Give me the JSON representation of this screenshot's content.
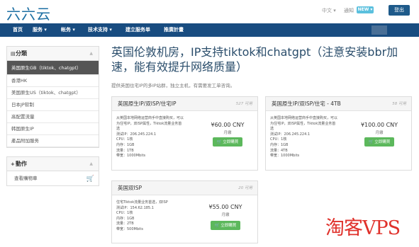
{
  "header": {
    "logo": "六六云",
    "language": "中文 ▾",
    "notice": "通知",
    "new_badge": "NEW ▾",
    "login": "登出"
  },
  "nav": {
    "items": [
      "首页",
      "服务 ▾",
      "帐务 ▾",
      "技术支持 ▾",
      "建立服务单",
      "推廣計畫"
    ]
  },
  "sidebar": {
    "categories_title": "分類",
    "categories": [
      "英国原生GB（tiktok、chatgpt）",
      "香港HK",
      "美国原生US（tiktok、chatgpt）",
      "日本JP软制",
      "高配置流量",
      "韩国原生IP",
      "產品附加服务"
    ],
    "actions_title": "動作",
    "actions": [
      "查看購物車"
    ]
  },
  "main": {
    "title": "英国伦敦机房，IP支持tiktok和chatgpt（注意安装bbr加速，能有效提升网络质量）",
    "subtitle": "提供英国住宅IP的多IP站群，独立主机，有需要发工单咨询。",
    "order_label": "立即購買",
    "products": [
      {
        "name": "英国原生IP/双ISP/住宅IP",
        "stock": "527 可用",
        "desc": [
          "从英国本地网络运营商手中直接购买，可以",
          "为住宅IP，双ISP属性，Tiktok流量业务首",
          "选",
          "测试IP：206.245.224.1",
          "CPU：1核",
          "内存：1GB",
          "流量：1TB",
          "带宽：1000Mbits"
        ],
        "price": "¥60.00 CNY",
        "cycle": "月繳"
      },
      {
        "name": "英国原生IP/双ISP/住宅 - 4TB",
        "stock": "58 可用",
        "desc": [
          "从英国本地网络运营商手中直接购买，可以",
          "为住宅IP，双ISP属性，Tiktok流量业务首",
          "选",
          "测试IP：206.245.224.1",
          "CPU：1核",
          "内存：1GB",
          "流量：4TB",
          "带宽：1000Mbits"
        ],
        "price": "¥100.00 CNY",
        "cycle": "月繳"
      },
      {
        "name": "英国双ISP",
        "stock": "20 可用",
        "desc": [
          "住宅Tiktok流量业务首选，双ISP",
          "测试IP：154.62.185.1",
          "CPU：1核",
          "内存：1GB",
          "流量：2TB",
          "带宽：500Mbits"
        ],
        "price": "¥55.00 CNY",
        "cycle": "月繳"
      }
    ]
  },
  "watermark": "淘客VPS"
}
